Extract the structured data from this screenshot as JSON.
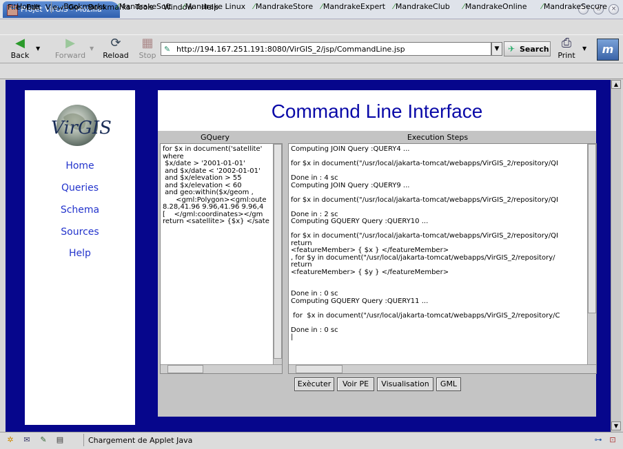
{
  "window": {
    "title": "Projet VirGIS - Mozilla"
  },
  "menu": [
    "File",
    "Edit",
    "View",
    "Go",
    "Bookmarks",
    "Tools",
    "Window",
    "Help"
  ],
  "toolbar": {
    "back": "Back",
    "forward": "Forward",
    "reload": "Reload",
    "stop": "Stop",
    "url": "http://194.167.251.191:8080/VirGIS_2/jsp/CommandLine.jsp",
    "search": "Search",
    "print": "Print"
  },
  "bookmarks": [
    "Home",
    "Bookmarks",
    "MandrakeSoft",
    "Mandrake Linux",
    "MandrakeStore",
    "MandrakeExpert",
    "MandrakeClub",
    "MandrakeOnline",
    "MandrakeSecure"
  ],
  "sidebar": {
    "logo_text": "VirGIS",
    "links": [
      "Home",
      "Queries",
      "Schema",
      "Sources",
      "Help"
    ]
  },
  "page": {
    "title": "Command Line Interface"
  },
  "applet": {
    "gquery_header": "GQuery",
    "steps_header": "Execution Steps",
    "gquery_lines": [
      "for $x in document('satellite'",
      "where",
      " $x/date > '2001-01-01'",
      " and $x/date < '2002-01-01'",
      " and $x/elevation > 55",
      " and $x/elevation < 60",
      " and geo:within($x/geom ,",
      "      <gml:Polygon><gml:oute",
      "8.28,41.96 9.96,41.96 9.96,4",
      "[    </gml:coordinates></gm",
      "return <satellite> {$x} </sate"
    ],
    "steps_lines": [
      "Computing JOIN Query :QUERY4 ...",
      "",
      "for $x in document(\"/usr/local/jakarta-tomcat/webapps/VirGIS_2/repository/QI",
      "",
      "Done in : 4 sc",
      "Computing JOIN Query :QUERY9 ...",
      "",
      "for $x in document(\"/usr/local/jakarta-tomcat/webapps/VirGIS_2/repository/QI",
      "",
      "Done in : 2 sc",
      "Computing GQUERY Query :QUERY10 ...",
      "",
      "for $x in document(\"/usr/local/jakarta-tomcat/webapps/VirGIS_2/repository/QI",
      "return",
      "<featureMember> { $x } </featureMember>",
      ", for $y in document(\"/usr/local/jakarta-tomcat/webapps/VirGIS_2/repository/",
      "return",
      "<featureMember> { $y } </featureMember>",
      "",
      "",
      "Done in : 0 sc",
      "Computing GQUERY Query :QUERY11 ...",
      "",
      " for  $x in document(\"/usr/local/jakarta-tomcat/webapps/VirGIS_2/repository/C",
      "",
      "Done in : 0 sc",
      "|"
    ],
    "buttons": [
      "Exècuter",
      "Voir PE",
      "Visualisation",
      "GML"
    ]
  },
  "status": {
    "text": "Chargement de Applet Java"
  }
}
